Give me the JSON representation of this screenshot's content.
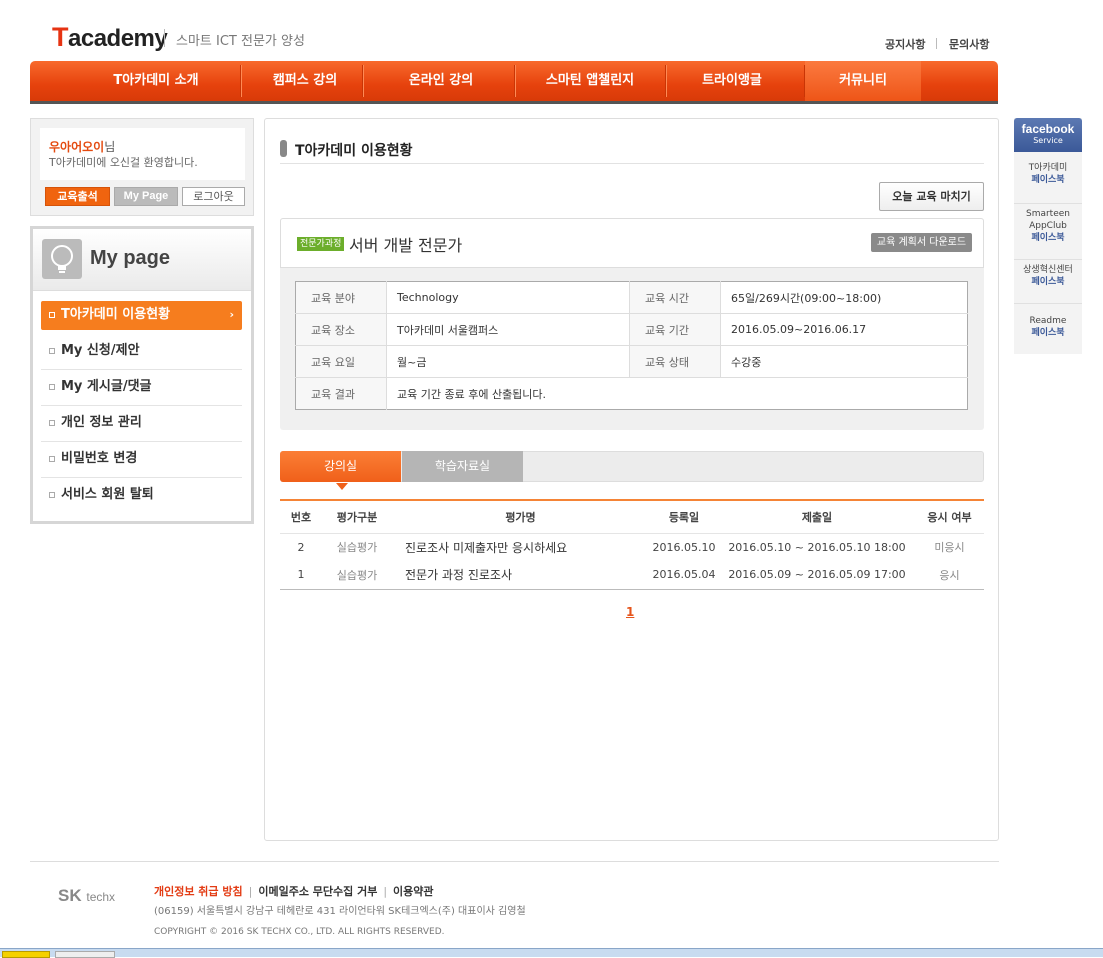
{
  "header": {
    "logo_t": "T",
    "logo_rest": "academy",
    "slogan": "스마트 ICT 전문가 양성",
    "links": [
      "공지사항",
      "문의사항"
    ]
  },
  "nav": {
    "items": [
      "T아카데미 소개",
      "캠퍼스 강의",
      "온라인 강의",
      "스마틴 앱챌린지",
      "트라이앵글",
      "커뮤니티"
    ]
  },
  "login": {
    "username": "우아어오이",
    "username_suffix": "님",
    "welcome": "T아카데미에 오신걸 환영합니다.",
    "btn_attend": "교육출석",
    "btn_mypage": "My Page",
    "btn_logout": "로그아웃"
  },
  "sidebar": {
    "title": "My page",
    "items": [
      "T아카데미 이용현황",
      "My 신청/제안",
      "My 게시글/댓글",
      "개인 정보 관리",
      "비밀번호 변경",
      "서비스 회원 탈퇴"
    ],
    "active_chevron": "›"
  },
  "main": {
    "title": "T아카데미 이용현황",
    "btn_finish": "오늘 교육 마치기",
    "course": {
      "badge": "전문가과정",
      "name": "서버 개발 전문가",
      "btn_plan": "교육 계획서 다운로드",
      "info": {
        "field_label": "교육 분야",
        "field": "Technology",
        "time_label": "교육 시간",
        "time": "65일/269시간(09:00~18:00)",
        "place_label": "교육 장소",
        "place": "T아카데미 서울캠퍼스",
        "period_label": "교육 기간",
        "period": "2016.05.09~2016.06.17",
        "days_label": "교육 요일",
        "days": "월~금",
        "status_label": "교육 상태",
        "status": "수강중",
        "result_label": "교육 결과",
        "result": "교육 기간 종료 후에 산출됩니다."
      }
    },
    "tabs": [
      "강의실",
      "학습자료실"
    ],
    "table": {
      "headers": [
        "번호",
        "평가구분",
        "평가명",
        "등록일",
        "제출일",
        "응시 여부"
      ],
      "rows": [
        [
          "2",
          "실습평가",
          "진로조사 미제출자만 응시하세요",
          "2016.05.10",
          "2016.05.10 ~ 2016.05.10 18:00",
          "미응시"
        ],
        [
          "1",
          "실습평가",
          "전문가 과정 진로조사",
          "2016.05.04",
          "2016.05.09 ~ 2016.05.09 17:00",
          "응시"
        ]
      ]
    },
    "pager": "1"
  },
  "facebook": {
    "title": "facebook",
    "subtitle": "Service",
    "items": [
      {
        "name": "T아카데미",
        "link": "페이스북"
      },
      {
        "name": "Smarteen AppClub",
        "link": "페이스북"
      },
      {
        "name": "상생혁신센터",
        "link": "페이스북"
      },
      {
        "name": "Readme",
        "link": "페이스북"
      }
    ]
  },
  "footer": {
    "logo_sk": "SK",
    "logo_techx": "techx",
    "link_privacy": "개인정보 취급 방침",
    "link_email": "이메일주소 무단수집 거부",
    "link_terms": "이용약관",
    "sep": "|",
    "address": "(06159) 서울특별시 강남구 테헤란로 431 라이언타워 SK테크엑스(주) 대표이사 김영철",
    "copyright": "COPYRIGHT © 2016 SK TECHX CO., LTD.  ALL RIGHTS RESERVED."
  },
  "colors": {
    "accent": "#f0601a",
    "brand_red": "#e63312",
    "facebook": "#3b5998"
  }
}
